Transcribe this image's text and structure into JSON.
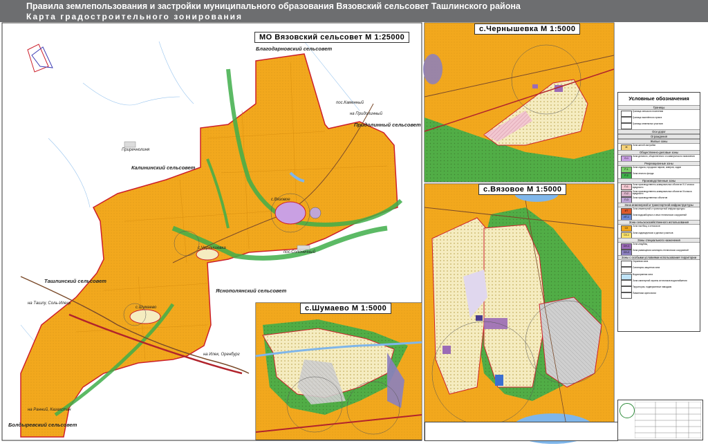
{
  "header": {
    "title_line1": "Правила землепользования и застройки муниципального образования Вязовский сельсовет Ташлинского района",
    "title_line2": "Карта градостроительного зонирования"
  },
  "panels": {
    "main": "МО Вязовский сельсовет М 1:25000",
    "chernyshevka": "с.Чернышевка М 1:5000",
    "vyazovoe": "с.Вязовое М 1:5000",
    "shumaevo": "с.Шумаево М 1:5000"
  },
  "map_labels": {
    "blagodarnovsky": "Благодарновский сельсовет",
    "prigorodny": "Придолинный сельсовет",
    "na_pridolinny": "на Придолинный",
    "kalininsky": "Калининский сельсовет",
    "tashlinsky": "Ташлинский сельсовет",
    "yasnopolyansky": "Яснополянский сельсовет",
    "boldyrevsky": "Болдыревский сельсовет",
    "na_tashla": "на Ташлу, Соль-Илецк",
    "na_iletsk": "на Илек, Оренбург",
    "na_ranni": "на Ранний, Казахстан",
    "pos_kamenny": "пос.Каменный",
    "pos_solonechny": "пос.Солонечный",
    "prirechnoe": "Приречнолиня",
    "vyazovoe_small": "с.Вязовое",
    "chernyshevka_small": "с.Чернышевка",
    "shumaevo_small": "с.Шумаево"
  },
  "legend": {
    "title": "Условные обозначения",
    "sections": [
      "Границы",
      "Оси дорог",
      "Ограждения",
      "Жилые зоны",
      "Общественно-деловые зоны",
      "Рекреационные зоны",
      "Производственные зоны",
      "Зона инженерной и транспортной инфраструктуры",
      "Зона сельскохозяйственного использования",
      "Зоны специального назначения",
      "Зоны с особыми условиями использования территории"
    ],
    "items": [
      {
        "code": "",
        "color": "#ffffff",
        "text": "Граница сельского поселения"
      },
      {
        "code": "",
        "color": "#ffffff",
        "text": "Граница населённого пункта"
      },
      {
        "code": "",
        "color": "#ffffff",
        "text": "Границы земельных участков"
      },
      {
        "code": "Ж",
        "color": "#f5d27a",
        "text": "Зона жилой застройки"
      },
      {
        "code": "О-1",
        "color": "#c9a0e3",
        "text": "Зона делового, общественного и коммерческого назначения"
      },
      {
        "code": "Р-1",
        "color": "#7ccf6a",
        "text": "Зона отдыха, городских парков, скверов, садов"
      },
      {
        "code": "Р-2",
        "color": "#3fae4a",
        "text": "Зона лесного фонда"
      },
      {
        "code": "П-1",
        "color": "#f2c7d0",
        "text": "Зона производственно-коммунальных объектов IV-V класса вредности"
      },
      {
        "code": "П-2",
        "color": "#d9b3c8",
        "text": "Зона производственно-коммунальных объектов III класса вредности"
      },
      {
        "code": "П-3",
        "color": "#bfa6d6",
        "text": "Зона производственных объектов"
      },
      {
        "code": "ИТ",
        "color": "#e05a2a",
        "text": "Зона инженерной и транспортной инфраструктуры"
      },
      {
        "code": "ИТ-1",
        "color": "#6c8ad8",
        "text": "Зона водозаборных и иных технических сооружений"
      },
      {
        "code": "СХ",
        "color": "#f2a81d",
        "text": "Зона пастбищ и сенокосов"
      },
      {
        "code": "СХ-1",
        "color": "#fce36b",
        "text": "Зона садоводческих и дачных участков"
      },
      {
        "code": "СН-1",
        "color": "#9b6bb6",
        "text": "Зона кладбищ"
      },
      {
        "code": "СН-2",
        "color": "#8b7fbf",
        "text": "Зона размещения санитарно-технических сооружений"
      },
      {
        "code": "",
        "color": "#ffffff",
        "text": "Охранная зона"
      },
      {
        "code": "",
        "color": "#ffffff",
        "text": "Санитарно-защитная зона"
      },
      {
        "code": "",
        "color": "#bfe3f7",
        "text": "Водоохранная зона"
      },
      {
        "code": "",
        "color": "#ffffff",
        "text": "Зона санитарной охраны источников водоснабжения"
      },
      {
        "code": "",
        "color": "#ffffff",
        "text": "Территории, подверженные паводкам"
      },
      {
        "code": "",
        "color": "#ffffff",
        "text": "Памятники археологии"
      }
    ]
  },
  "colors": {
    "agri_orange": "#f2a81d",
    "forest_green": "#3fae4a",
    "recreation_green": "#7ccf6a",
    "water_blue": "#7fb6ea",
    "residential_cream": "#f5ecc0",
    "public_purple": "#9b6bb6",
    "industrial_pink": "#f2c7d0",
    "boundary_red": "#cc1f2b",
    "road_brown": "#7a4a2a",
    "title_gray": "#6d6e70"
  }
}
